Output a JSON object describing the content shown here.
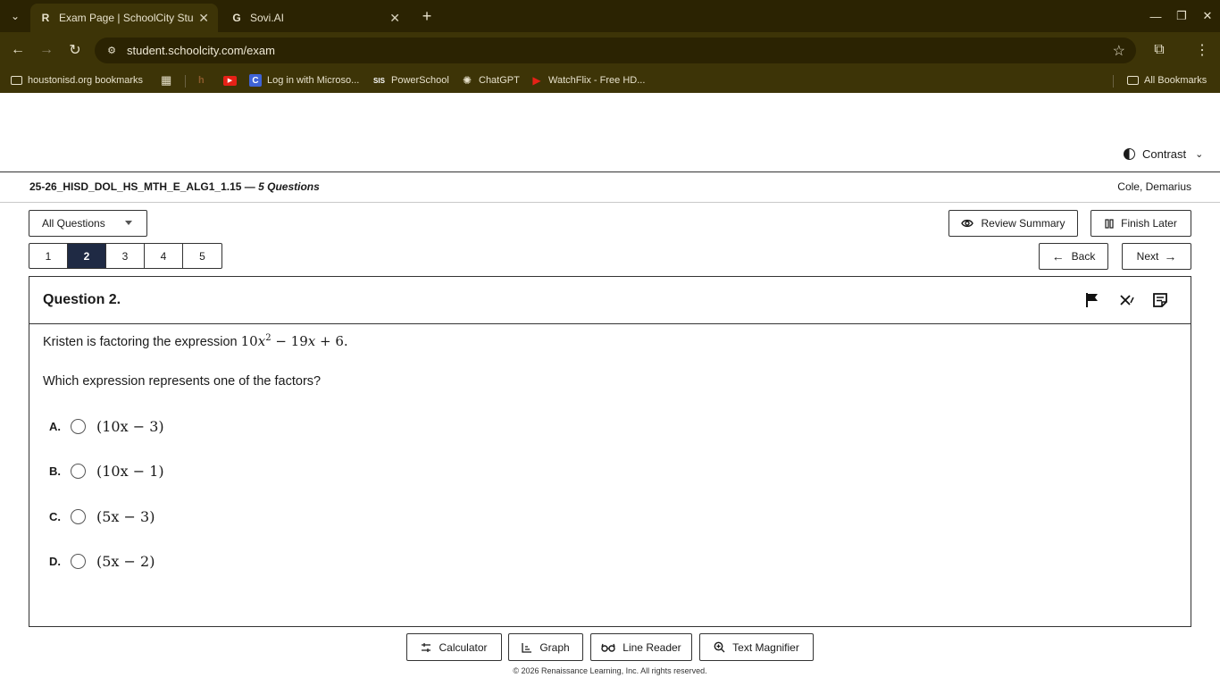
{
  "browser": {
    "tabs": [
      {
        "title": "Exam Page | SchoolCity Studen",
        "active": true
      },
      {
        "title": "Sovi.AI",
        "active": false
      }
    ],
    "url": "student.schoolcity.com/exam",
    "bookmarks": [
      {
        "label": "houstonisd.org bookmarks"
      },
      {
        "label": "Log in with Microso..."
      },
      {
        "label": "PowerSchool"
      },
      {
        "label": "ChatGPT"
      },
      {
        "label": "WatchFlix - Free HD..."
      }
    ],
    "all_bookmarks": "All Bookmarks"
  },
  "page": {
    "contrast_label": "Contrast",
    "exam_title": "25-26_HISD_DOL_HS_MTH_E_ALG1_1.15 —",
    "question_count": "5 Questions",
    "student_name": "Cole, Demarius",
    "filter_label": "All Questions",
    "question_numbers": [
      "1",
      "2",
      "3",
      "4",
      "5"
    ],
    "current_question": "2",
    "review_summary": "Review Summary",
    "finish_later": "Finish Later",
    "back": "Back",
    "next": "Next",
    "question": {
      "title": "Question 2.",
      "stem_prefix": "Kristen is factoring the expression",
      "prompt": "Which expression represents one of the factors?",
      "choices": [
        {
          "letter": "A.",
          "answer": "(10x − 3)"
        },
        {
          "letter": "B.",
          "answer": "(10x − 1)"
        },
        {
          "letter": "C.",
          "answer": "(5x − 3)"
        },
        {
          "letter": "D.",
          "answer": "(5x − 2)"
        }
      ]
    },
    "tools": [
      "Calculator",
      "Graph",
      "Line Reader",
      "Text Magnifier"
    ],
    "footer": "© 2026 Renaissance Learning, Inc. All rights reserved."
  },
  "colors": {
    "chrome_dark": "#2b2302",
    "chrome_toolbar": "#3d3407",
    "active_question": "#1f2a44"
  }
}
